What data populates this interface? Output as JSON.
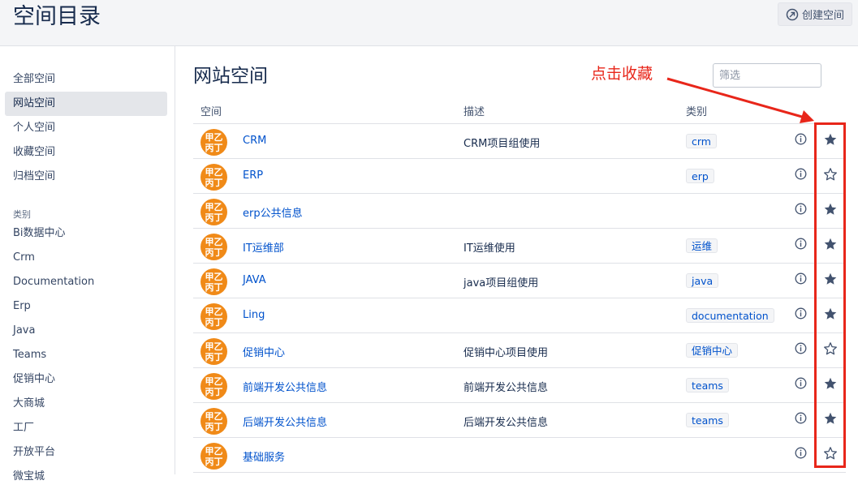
{
  "header": {
    "title": "空间目录",
    "create_label": "创建空间"
  },
  "sidebar": {
    "items": [
      {
        "label": "全部空间",
        "active": false
      },
      {
        "label": "网站空间",
        "active": true
      },
      {
        "label": "个人空间",
        "active": false
      },
      {
        "label": "收藏空间",
        "active": false
      },
      {
        "label": "归档空间",
        "active": false
      }
    ],
    "category_heading": "类别",
    "categories": [
      "Bi数据中心",
      "Crm",
      "Documentation",
      "Erp",
      "Java",
      "Teams",
      "促销中心",
      "大商城",
      "工厂",
      "开放平台",
      "微宝城"
    ]
  },
  "main": {
    "title": "网站空间",
    "filter_placeholder": "筛选",
    "annotation": "点击收藏",
    "columns": {
      "space": "空间",
      "description": "描述",
      "category": "类别"
    },
    "avatar_text": [
      "甲乙",
      "丙丁"
    ],
    "rows": [
      {
        "name": "CRM",
        "description": "CRM项目组使用",
        "tag": "crm",
        "starred": true
      },
      {
        "name": "ERP",
        "description": "",
        "tag": "erp",
        "starred": false
      },
      {
        "name": "erp公共信息",
        "description": "",
        "tag": "",
        "starred": true
      },
      {
        "name": "IT运维部",
        "description": "IT运维使用",
        "tag": "运维",
        "starred": true
      },
      {
        "name": "JAVA",
        "description": "java项目组使用",
        "tag": "java",
        "starred": true
      },
      {
        "name": "Ling",
        "description": "",
        "tag": "documentation",
        "starred": true
      },
      {
        "name": "促销中心",
        "description": "促销中心项目使用",
        "tag": "促销中心",
        "starred": false
      },
      {
        "name": "前端开发公共信息",
        "description": "前端开发公共信息",
        "tag": "teams",
        "starred": true
      },
      {
        "name": "后端开发公共信息",
        "description": "后端开发公共信息",
        "tag": "teams",
        "starred": true
      },
      {
        "name": "基础服务",
        "description": "",
        "tag": "",
        "starred": false
      }
    ]
  },
  "colors": {
    "accent": "#0052cc",
    "annotation": "#e8261a",
    "avatar": "#f08a18",
    "star": "#42526e"
  },
  "icons": {
    "create": "create-space-icon",
    "info": "info-icon",
    "star_filled": "star-filled-icon",
    "star_outline": "star-outline-icon"
  }
}
